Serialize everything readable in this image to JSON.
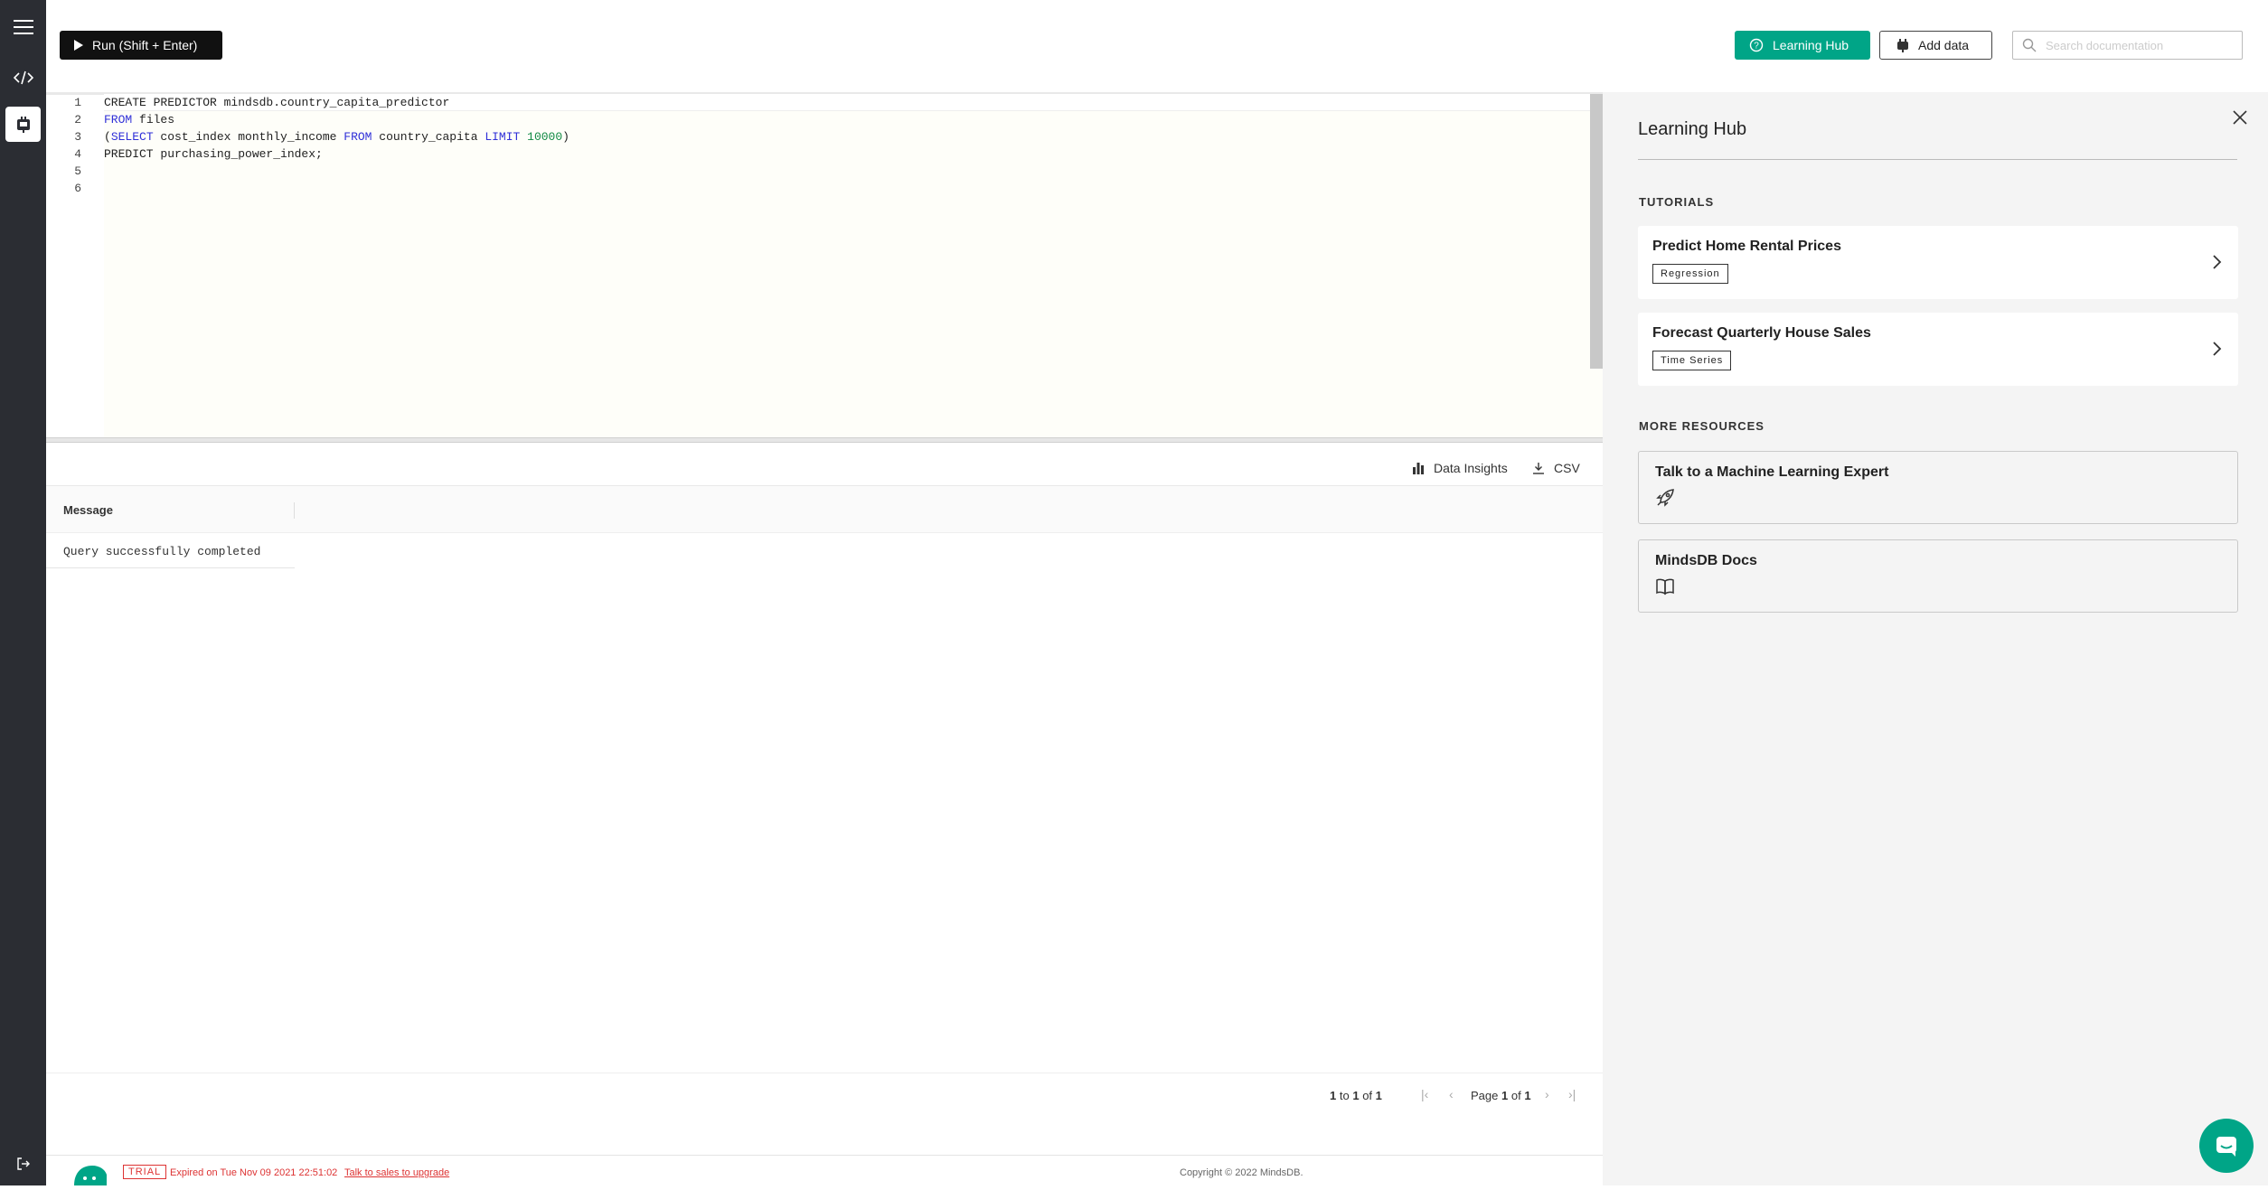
{
  "toolbar": {
    "run_label": "Run (Shift + Enter)",
    "learning_hub_label": "Learning Hub",
    "add_data_label": "Add data",
    "search_placeholder": "Search documentation"
  },
  "editor": {
    "lines": [
      {
        "no": "1",
        "tokens": [
          {
            "t": "CREATE",
            "k": "plain"
          },
          {
            "t": " PREDICTOR mindsdb.country_capita_predictor",
            "k": "plain"
          }
        ]
      },
      {
        "no": "2",
        "tokens": [
          {
            "t": "FROM",
            "k": "kw"
          },
          {
            "t": " files",
            "k": "plain"
          }
        ]
      },
      {
        "no": "3",
        "tokens": [
          {
            "t": "(",
            "k": "plain"
          },
          {
            "t": "SELECT",
            "k": "kw"
          },
          {
            "t": " cost_index monthly_income ",
            "k": "plain"
          },
          {
            "t": "FROM",
            "k": "kw"
          },
          {
            "t": " country_capita ",
            "k": "plain"
          },
          {
            "t": "LIMIT",
            "k": "kw"
          },
          {
            "t": " ",
            "k": "plain"
          },
          {
            "t": "10000",
            "k": "num"
          },
          {
            "t": ")",
            "k": "plain"
          }
        ]
      },
      {
        "no": "4",
        "tokens": [
          {
            "t": "PREDICT purchasing_power_index;",
            "k": "plain"
          }
        ]
      },
      {
        "no": "5",
        "tokens": []
      },
      {
        "no": "6",
        "tokens": []
      }
    ]
  },
  "results": {
    "data_insights_label": "Data Insights",
    "csv_label": "CSV",
    "column_header": "Message",
    "rows": [
      "Query successfully completed"
    ],
    "pager": {
      "range_from": "1",
      "range_to": "1",
      "total": "1",
      "to_word": "to",
      "of_word": "of",
      "page_word": "Page",
      "page_current": "1",
      "page_total": "1"
    }
  },
  "footer": {
    "trial_badge": "TRIAL",
    "expired_text": "Expired on Tue Nov 09 2021 22:51:02",
    "upgrade_link": "Talk to sales to upgrade",
    "copyright": "Copyright © 2022 MindsDB."
  },
  "learning_hub": {
    "title": "Learning Hub",
    "tutorials_heading": "TUTORIALS",
    "tutorials": [
      {
        "title": "Predict Home Rental Prices",
        "tag": "Regression"
      },
      {
        "title": "Forecast Quarterly House Sales",
        "tag": "Time Series"
      }
    ],
    "resources_heading": "MORE RESOURCES",
    "resources": [
      {
        "title": "Talk to a Machine Learning Expert",
        "icon": "rocket-icon"
      },
      {
        "title": "MindsDB Docs",
        "icon": "book-icon"
      }
    ]
  },
  "colors": {
    "accent": "#00a587",
    "rail": "#2b2d33",
    "warning": "#dd3333",
    "keyword": "#2f2fd8",
    "number": "#118a44"
  }
}
